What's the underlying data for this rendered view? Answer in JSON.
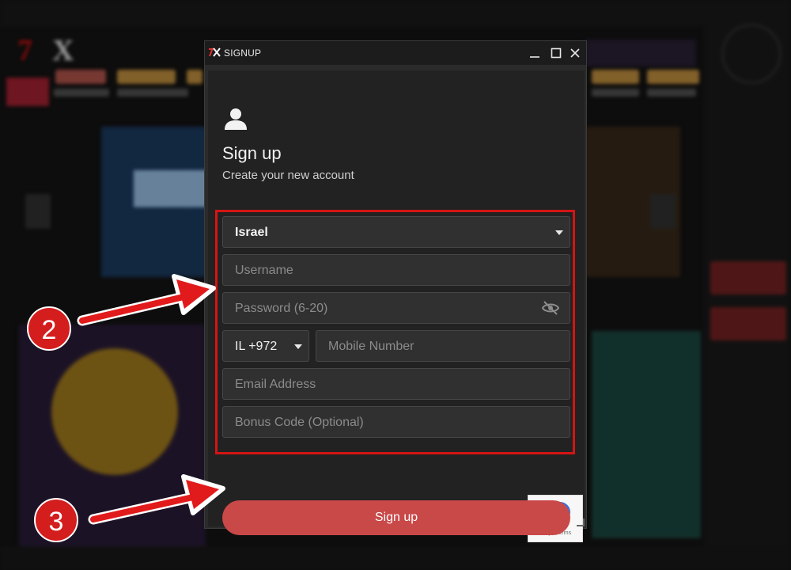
{
  "window": {
    "title": "SIGNUP",
    "icon": "app-logo-icon",
    "controls": [
      "minimize-icon",
      "maximize-icon",
      "close-icon"
    ]
  },
  "header": {
    "icon": "user-icon",
    "title": "Sign up",
    "subtitle": "Create your new account"
  },
  "form": {
    "country": {
      "value": "Israel",
      "icon": "caret-down-icon"
    },
    "username": {
      "placeholder": "Username"
    },
    "password": {
      "placeholder": "Password (6-20)",
      "icon": "eye-off-icon"
    },
    "phone_code": {
      "value": "IL +972",
      "icon": "caret-down-icon"
    },
    "mobile": {
      "placeholder": "Mobile Number"
    },
    "email": {
      "placeholder": "Email Address"
    },
    "bonus": {
      "placeholder": "Bonus Code (Optional)"
    },
    "submit_label": "Sign up"
  },
  "recaptcha": {
    "text": "Privacy - Terms",
    "icon": "recaptcha-icon"
  },
  "annotations": {
    "step2": "2",
    "step3": "3",
    "color": "#d41d1d"
  },
  "colors": {
    "accent": "#c94848",
    "window_bg": "#222222",
    "field_bg": "#303030"
  }
}
